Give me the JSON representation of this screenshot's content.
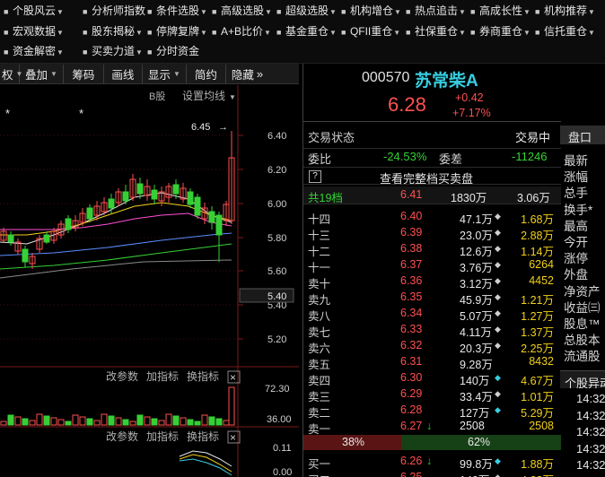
{
  "menu": {
    "row1": [
      "个股风云",
      "分析师指数",
      "条件选股",
      "高级选股",
      "超级选股",
      "机构增仓",
      "热点追击",
      "高成长性",
      "机构推荐"
    ],
    "row2": [
      "宏观数据",
      "股东揭秘",
      "停牌复牌",
      "A+B比价",
      "基金重仓",
      "QFII重仓",
      "社保重仓",
      "券商重仓",
      "信托重仓"
    ],
    "row3": [
      "资金解密",
      "买卖力道",
      "分时资金"
    ]
  },
  "toolbar": {
    "items": [
      "叠加",
      "筹码",
      "画线",
      "显示",
      "简约",
      "隐藏"
    ],
    "first_fragment": "权",
    "more": "»"
  },
  "chart": {
    "b_share": "B股",
    "setting": "设置均线",
    "high_marker": "6.45",
    "price_ticks": [
      "6.40",
      "6.20",
      "6.00",
      "5.80",
      "5.60",
      "5.40",
      "5.20",
      "5.00"
    ],
    "current_tag": "5.40",
    "volume_ticks": [
      "72.30",
      "36.00"
    ],
    "macd_ticks": [
      "0.11",
      "0.00"
    ],
    "panel_labels": {
      "params": "改参数",
      "add": "加指标",
      "switch": "换指标",
      "close": "×"
    }
  },
  "stock": {
    "code": "000570",
    "name": "苏常柴A",
    "price": "6.28",
    "change": "+0.42",
    "change_pct": "+7.17%"
  },
  "status": {
    "label": "交易状态",
    "value": "交易中"
  },
  "ratio": {
    "label": "委比",
    "value": "-24.53%",
    "diff_label": "委差",
    "diff_value": "-11246"
  },
  "full_book": {
    "icon": "?",
    "label": "查看完整档买卖盘"
  },
  "summary": {
    "label": "共19档",
    "price": "6.41",
    "volume": "1830万",
    "amount": "3.06万"
  },
  "asks": [
    {
      "label": "十四",
      "price": "6.40",
      "vol": "47.1万",
      "diamond": "yes",
      "amount": "1.68万"
    },
    {
      "label": "十三",
      "price": "6.39",
      "vol": "23.0万",
      "diamond": "yes",
      "amount": "2.88万"
    },
    {
      "label": "十二",
      "price": "6.38",
      "vol": "12.6万",
      "diamond": "yes",
      "amount": "1.14万"
    },
    {
      "label": "十一",
      "price": "6.37",
      "vol": "3.76万",
      "diamond": "yes",
      "amount": "6264"
    },
    {
      "label": "卖十",
      "price": "6.36",
      "vol": "3.12万",
      "diamond": "yes",
      "amount": "4452"
    },
    {
      "label": "卖九",
      "price": "6.35",
      "vol": "45.9万",
      "diamond": "yes",
      "amount": "1.21万"
    },
    {
      "label": "卖八",
      "price": "6.34",
      "vol": "5.07万",
      "diamond": "yes",
      "amount": "1.27万"
    },
    {
      "label": "卖七",
      "price": "6.33",
      "vol": "4.11万",
      "diamond": "yes",
      "amount": "1.37万"
    },
    {
      "label": "卖六",
      "price": "6.32",
      "vol": "20.3万",
      "diamond": "yes",
      "amount": "2.25万"
    },
    {
      "label": "卖五",
      "price": "6.31",
      "vol": "9.28万",
      "diamond": "no",
      "amount": "8432"
    },
    {
      "label": "卖四",
      "price": "6.30",
      "vol": "140万",
      "diamond": "cyan",
      "amount": "4.67万"
    },
    {
      "label": "卖三",
      "price": "6.29",
      "vol": "33.4万",
      "diamond": "yes",
      "amount": "1.01万"
    },
    {
      "label": "卖二",
      "price": "6.28",
      "vol": "127万",
      "diamond": "cyan",
      "amount": "5.29万"
    },
    {
      "label": "卖一",
      "price": "6.27",
      "arrow": "↓",
      "vol": "2508",
      "diamond": "no",
      "amount": "2508"
    }
  ],
  "balance": {
    "sell_pct": "38%",
    "buy_pct": "62%",
    "sell_frac": 0.38
  },
  "bids": [
    {
      "label": "买一",
      "price": "6.26",
      "arrow": "↓",
      "vol": "99.8万",
      "diamond": "cyan",
      "amount": "1.88万"
    },
    {
      "label": "买二",
      "price": "6.25",
      "vol": "140万",
      "diamond": "yes",
      "amount": "4.23万"
    }
  ],
  "side_panel": {
    "tab": "盘口",
    "fields": [
      "最新",
      "涨幅",
      "总手",
      "换手*",
      "最高",
      "今开",
      "涨停",
      "外盘",
      "净资产",
      "收益㈢",
      "股息™",
      "总股本",
      "流通股"
    ],
    "section": "个股异动",
    "times": [
      "14:32",
      "14:32",
      "14:32",
      "14:32",
      "14:32"
    ]
  },
  "colors": {
    "up": "#ff5050",
    "down": "#34d233",
    "bg": "#000000",
    "accent": "#37cfe0",
    "amount": "#f1d01b"
  }
}
